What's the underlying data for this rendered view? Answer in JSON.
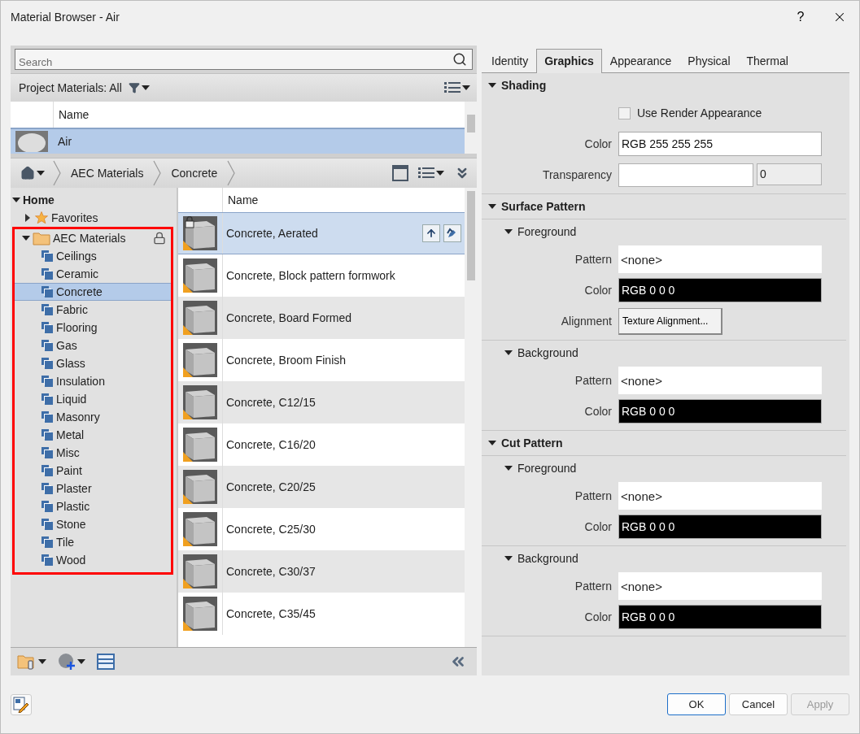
{
  "window": {
    "title": "Material Browser - Air",
    "help": "?"
  },
  "search": {
    "placeholder": "Search"
  },
  "project_materials": {
    "label": "Project Materials: All",
    "columns": [
      "Name"
    ],
    "rows": [
      {
        "name": "Air",
        "selected": true
      }
    ]
  },
  "breadcrumb": [
    "AEC Materials",
    "Concrete"
  ],
  "tree": {
    "label": "Home",
    "expanded": true,
    "children": [
      {
        "label": "Favorites",
        "kind": "favorites",
        "expanded": false,
        "locked": false,
        "highlighted": false
      },
      {
        "label": "AEC Materials",
        "kind": "library",
        "expanded": true,
        "locked": true,
        "highlighted": true,
        "children": [
          {
            "label": "Ceilings",
            "selected": false
          },
          {
            "label": "Ceramic",
            "selected": false
          },
          {
            "label": "Concrete",
            "selected": true
          },
          {
            "label": "Fabric",
            "selected": false
          },
          {
            "label": "Flooring",
            "selected": false
          },
          {
            "label": "Gas",
            "selected": false
          },
          {
            "label": "Glass",
            "selected": false
          },
          {
            "label": "Insulation",
            "selected": false
          },
          {
            "label": "Liquid",
            "selected": false
          },
          {
            "label": "Masonry",
            "selected": false
          },
          {
            "label": "Metal",
            "selected": false
          },
          {
            "label": "Misc",
            "selected": false
          },
          {
            "label": "Paint",
            "selected": false
          },
          {
            "label": "Plaster",
            "selected": false
          },
          {
            "label": "Plastic",
            "selected": false
          },
          {
            "label": "Stone",
            "selected": false
          },
          {
            "label": "Tile",
            "selected": false
          },
          {
            "label": "Wood",
            "selected": false
          }
        ]
      }
    ]
  },
  "library_list": {
    "columns": [
      "Name"
    ],
    "rows": [
      {
        "name": "Concrete, Aerated",
        "selected": true,
        "locked": true
      },
      {
        "name": "Concrete, Block pattern formwork",
        "selected": false,
        "locked": false
      },
      {
        "name": "Concrete, Board Formed",
        "selected": false,
        "locked": false
      },
      {
        "name": "Concrete, Broom Finish",
        "selected": false,
        "locked": false
      },
      {
        "name": "Concrete, C12/15",
        "selected": false,
        "locked": false
      },
      {
        "name": "Concrete, C16/20",
        "selected": false,
        "locked": false
      },
      {
        "name": "Concrete, C20/25",
        "selected": false,
        "locked": false
      },
      {
        "name": "Concrete, C25/30",
        "selected": false,
        "locked": false
      },
      {
        "name": "Concrete, C30/37",
        "selected": false,
        "locked": false
      },
      {
        "name": "Concrete, C35/45",
        "selected": false,
        "locked": false
      }
    ]
  },
  "tabs": [
    {
      "label": "Identity",
      "selected": false
    },
    {
      "label": "Graphics",
      "selected": true
    },
    {
      "label": "Appearance",
      "selected": false
    },
    {
      "label": "Physical",
      "selected": false
    },
    {
      "label": "Thermal",
      "selected": false
    }
  ],
  "sections": [
    {
      "title": "Shading",
      "expanded": true,
      "rows": [
        {
          "kind": "checkbox",
          "label": "Use Render Appearance",
          "checked": false
        },
        {
          "kind": "color",
          "label": "Color",
          "value": "RGB 255 255 255",
          "color": "#ffffff"
        },
        {
          "kind": "slider",
          "label": "Transparency",
          "value": "0",
          "level": 0
        }
      ]
    },
    {
      "title": "Surface Pattern",
      "expanded": true,
      "groups": [
        {
          "title": "Foreground",
          "expanded": true,
          "rows": [
            {
              "kind": "pattern",
              "label": "Pattern",
              "value": "<none>"
            },
            {
              "kind": "color",
              "label": "Color",
              "value": "RGB 0 0 0",
              "color": "#000000"
            },
            {
              "kind": "button",
              "label": "Alignment",
              "value": "Texture Alignment..."
            }
          ]
        },
        {
          "title": "Background",
          "expanded": true,
          "rows": [
            {
              "kind": "pattern",
              "label": "Pattern",
              "value": "<none>"
            },
            {
              "kind": "color",
              "label": "Color",
              "value": "RGB 0 0 0",
              "color": "#000000"
            }
          ]
        }
      ]
    },
    {
      "title": "Cut Pattern",
      "expanded": true,
      "groups": [
        {
          "title": "Foreground",
          "expanded": true,
          "rows": [
            {
              "kind": "pattern",
              "label": "Pattern",
              "value": "<none>"
            },
            {
              "kind": "color",
              "label": "Color",
              "value": "RGB 0 0 0",
              "color": "#000000"
            }
          ]
        },
        {
          "title": "Background",
          "expanded": true,
          "rows": [
            {
              "kind": "pattern",
              "label": "Pattern",
              "value": "<none>"
            },
            {
              "kind": "color",
              "label": "Color",
              "value": "RGB 0 0 0",
              "color": "#000000"
            }
          ]
        }
      ]
    }
  ],
  "buttons": [
    {
      "label": "OK",
      "default": true,
      "disabled": false
    },
    {
      "label": "Cancel",
      "default": false,
      "disabled": false
    },
    {
      "label": "Apply",
      "default": false,
      "disabled": true
    }
  ]
}
